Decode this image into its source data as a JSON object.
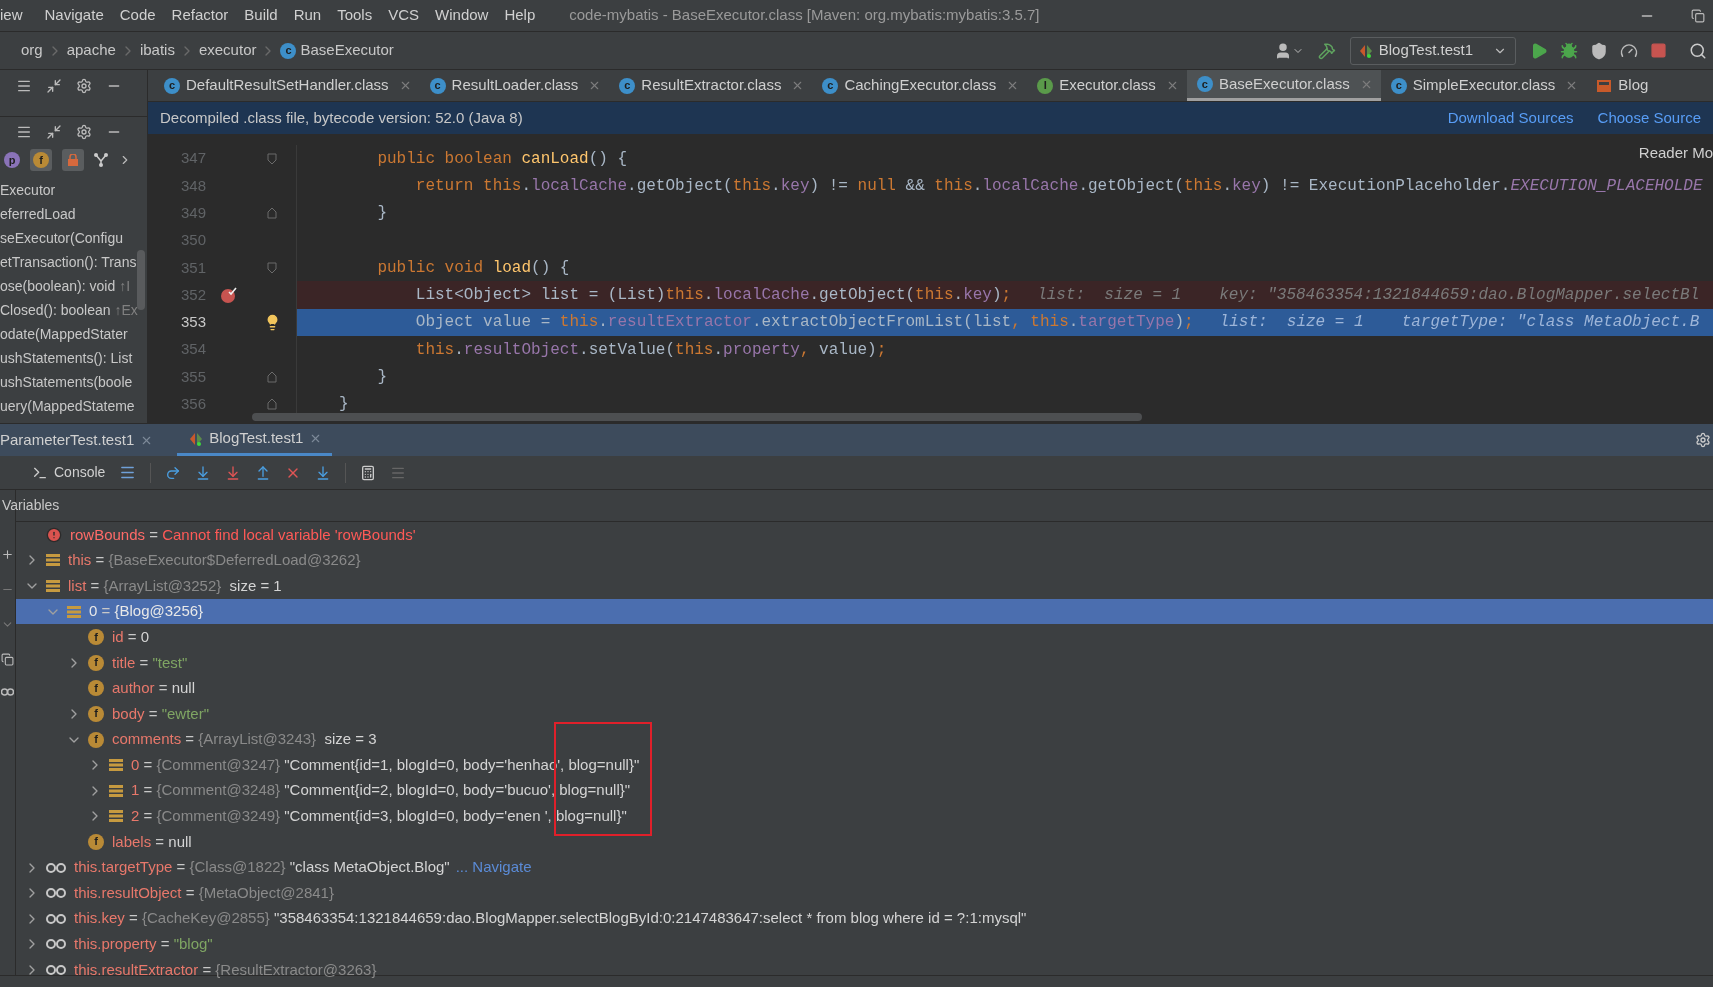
{
  "menu_bar": {
    "items": [
      "iew",
      "Navigate",
      "Code",
      "Refactor",
      "Build",
      "Run",
      "Tools",
      "VCS",
      "Window",
      "Help"
    ],
    "window_title": "code-mybatis - BaseExecutor.class [Maven: org.mybatis:mybatis:3.5.7]"
  },
  "breadcrumb": [
    {
      "label": "org",
      "kind": "package"
    },
    {
      "label": "apache",
      "kind": "package"
    },
    {
      "label": "ibatis",
      "kind": "package"
    },
    {
      "label": "executor",
      "kind": "package"
    },
    {
      "label": "BaseExecutor",
      "kind": "class",
      "icon_letter": "c"
    }
  ],
  "run_configuration": {
    "label": "BlogTest.test1"
  },
  "structure_panel": {
    "filter_letters": [
      "p",
      "f"
    ],
    "items": [
      {
        "label": "Executor"
      },
      {
        "label": "eferredLoad"
      },
      {
        "label": "seExecutor(Configu"
      },
      {
        "label": "etTransaction(): Trans"
      },
      {
        "label": "ose(boolean): void",
        "suffix": "↑I"
      },
      {
        "label": "Closed(): boolean",
        "suffix": "↑Ex"
      },
      {
        "label": "odate(MappedStater"
      },
      {
        "label": "ushStatements(): List"
      },
      {
        "label": "ushStatements(boole"
      },
      {
        "label": "uery(MappedStateme"
      }
    ]
  },
  "editor_tabs": [
    {
      "label": "DefaultResultSetHandler.class",
      "kind": "class",
      "icon_letter": "c",
      "selected": false
    },
    {
      "label": "ResultLoader.class",
      "kind": "class",
      "icon_letter": "c",
      "selected": false
    },
    {
      "label": "ResultExtractor.class",
      "kind": "class",
      "icon_letter": "c",
      "selected": false
    },
    {
      "label": "CachingExecutor.class",
      "kind": "class",
      "icon_letter": "c",
      "selected": false
    },
    {
      "label": "Executor.class",
      "kind": "interface",
      "icon_letter": "I",
      "selected": false
    },
    {
      "label": "BaseExecutor.class",
      "kind": "class",
      "icon_letter": "c",
      "selected": true
    },
    {
      "label": "SimpleExecutor.class",
      "kind": "class",
      "icon_letter": "c",
      "selected": false
    },
    {
      "label": "Blog",
      "kind": "xml",
      "selected": false
    }
  ],
  "banner": {
    "text": "Decompiled .class file, bytecode version: 52.0 (Java 8)",
    "links": [
      "Download Sources",
      "Choose Source"
    ]
  },
  "reader_mode": "Reader Mo",
  "code_lines": [
    {
      "number": "347",
      "fold": {
        "kind": "start"
      },
      "breakpoint": false,
      "execution_point": false,
      "tokens": [
        {
          "t": "    public boolean ",
          "kind": "kw"
        },
        {
          "t": "canLoad",
          "kind": "method"
        },
        {
          "t": "() {",
          "kind": "plain"
        }
      ]
    },
    {
      "number": "348",
      "breakpoint": false,
      "execution_point": false,
      "tokens": [
        {
          "t": "        return ",
          "kind": "kw"
        },
        {
          "t": "this",
          "kind": "kw"
        },
        {
          "t": ".",
          "kind": "plain"
        },
        {
          "t": "localCache",
          "kind": "field"
        },
        {
          "t": ".getObject(",
          "kind": "plain"
        },
        {
          "t": "this",
          "kind": "kw"
        },
        {
          "t": ".",
          "kind": "plain"
        },
        {
          "t": "key",
          "kind": "field"
        },
        {
          "t": ") != ",
          "kind": "plain"
        },
        {
          "t": "null",
          "kind": "kw"
        },
        {
          "t": " && ",
          "kind": "plain"
        },
        {
          "t": "this",
          "kind": "kw"
        },
        {
          "t": ".",
          "kind": "plain"
        },
        {
          "t": "localCache",
          "kind": "field"
        },
        {
          "t": ".getObject(",
          "kind": "plain"
        },
        {
          "t": "this",
          "kind": "kw"
        },
        {
          "t": ".",
          "kind": "plain"
        },
        {
          "t": "key",
          "kind": "field"
        },
        {
          "t": ") != ExecutionPlaceholder.",
          "kind": "plain"
        },
        {
          "t": "EXECUTION_PLACEHOLDE",
          "kind": "constant"
        }
      ]
    },
    {
      "number": "349",
      "fold": {
        "kind": "end"
      },
      "breakpoint": false,
      "execution_point": false,
      "tokens": [
        {
          "t": "    }",
          "kind": "plain"
        }
      ]
    },
    {
      "number": "350",
      "breakpoint": false,
      "execution_point": false
    },
    {
      "number": "351",
      "fold": {
        "kind": "start"
      },
      "breakpoint": false,
      "execution_point": false,
      "tokens": [
        {
          "t": "    public void ",
          "kind": "kw"
        },
        {
          "t": "load",
          "kind": "method"
        },
        {
          "t": "() {",
          "kind": "plain"
        }
      ]
    },
    {
      "number": "352",
      "breakpoint": true,
      "execution_point": false,
      "tokens": [
        {
          "t": "        List<Object> list = (List)",
          "kind": "plain"
        },
        {
          "t": "this",
          "kind": "kw"
        },
        {
          "t": ".",
          "kind": "plain"
        },
        {
          "t": "localCache",
          "kind": "field"
        },
        {
          "t": ".getObject(",
          "kind": "plain"
        },
        {
          "t": "this",
          "kind": "kw"
        },
        {
          "t": ".",
          "kind": "plain"
        },
        {
          "t": "key",
          "kind": "field"
        },
        {
          "t": ")",
          "kind": "plain"
        },
        {
          "t": ";",
          "kind": "kw"
        }
      ],
      "hints": [
        "list:  size = 1",
        "key: \"358463354:1321844659:dao.BlogMapper.selectBl"
      ]
    },
    {
      "number": "353",
      "breakpoint": false,
      "execution_point": true,
      "bulb": true,
      "tokens": [
        {
          "t": "        Object value = ",
          "kind": "plain"
        },
        {
          "t": "this",
          "kind": "kw"
        },
        {
          "t": ".",
          "kind": "plain"
        },
        {
          "t": "resultExtractor",
          "kind": "field"
        },
        {
          "t": ".extractObjectFromList(list",
          "kind": "plain"
        },
        {
          "t": ", ",
          "kind": "kw"
        },
        {
          "t": "this",
          "kind": "kw"
        },
        {
          "t": ".",
          "kind": "plain"
        },
        {
          "t": "targetType",
          "kind": "field"
        },
        {
          "t": ")",
          "kind": "plain"
        },
        {
          "t": ";",
          "kind": "kw"
        }
      ],
      "hints": [
        "list:  size = 1",
        "targetType: \"class MetaObject.B"
      ]
    },
    {
      "number": "354",
      "breakpoint": false,
      "execution_point": false,
      "tokens": [
        {
          "t": "        this",
          "kind": "kw"
        },
        {
          "t": ".",
          "kind": "plain"
        },
        {
          "t": "resultObject",
          "kind": "field"
        },
        {
          "t": ".setValue(",
          "kind": "plain"
        },
        {
          "t": "this",
          "kind": "kw"
        },
        {
          "t": ".",
          "kind": "plain"
        },
        {
          "t": "property",
          "kind": "field"
        },
        {
          "t": ", ",
          "kind": "kw"
        },
        {
          "t": "value)",
          "kind": "plain"
        },
        {
          "t": ";",
          "kind": "kw"
        }
      ]
    },
    {
      "number": "355",
      "fold": {
        "kind": "end"
      },
      "breakpoint": false,
      "execution_point": false,
      "tokens": [
        {
          "t": "    }",
          "kind": "plain"
        }
      ]
    },
    {
      "number": "356",
      "fold": {
        "kind": "end"
      },
      "breakpoint": false,
      "execution_point": false,
      "tokens": [
        {
          "t": "}",
          "kind": "plain"
        }
      ]
    }
  ],
  "debug": {
    "tabs": [
      {
        "label": "ParameterTest.test1",
        "selected": false
      },
      {
        "label": "BlogTest.test1",
        "selected": true
      }
    ],
    "console_label": "Console",
    "variables_title": "Variables",
    "annotation": {
      "kind": "rectangle",
      "color": "#e0202a"
    },
    "variables": [
      {
        "kind": "error",
        "name": "rowBounds",
        "equals": "=",
        "message": "Cannot find local variable 'rowBounds'",
        "selected": false
      },
      {
        "kind": "object",
        "name": "this",
        "equals": "=",
        "ref": "{BaseExecutor$DeferredLoad@3262}",
        "expanded": false,
        "selected": false
      },
      {
        "kind": "object",
        "name": "list",
        "equals": "=",
        "ref": "{ArrayList@3252}",
        "extra": "size = 1",
        "expanded": true,
        "selected": false,
        "children": [
          {
            "kind": "object",
            "name": "0",
            "equals": "=",
            "ref": "{Blog@3256}",
            "expanded": true,
            "selected": true,
            "children": [
              {
                "kind": "field",
                "icon_letter": "f",
                "name": "id",
                "equals": "=",
                "value": {
                  "text": "0",
                  "kind": "plain"
                },
                "selected": false
              },
              {
                "kind": "field",
                "icon_letter": "f",
                "name": "title",
                "equals": "=",
                "value": {
                  "text": "\"test\"",
                  "kind": "string"
                },
                "expanded": false,
                "selected": false
              },
              {
                "kind": "field",
                "icon_letter": "f",
                "name": "author",
                "equals": "=",
                "value": {
                  "text": "null",
                  "kind": "plain"
                },
                "selected": false
              },
              {
                "kind": "field",
                "icon_letter": "f",
                "name": "body",
                "equals": "=",
                "value": {
                  "text": "\"ewter\"",
                  "kind": "string"
                },
                "expanded": false,
                "selected": false
              },
              {
                "kind": "field",
                "icon_letter": "f",
                "name": "comments",
                "equals": "=",
                "ref": "{ArrayList@3243}",
                "extra": "size = 3",
                "expanded": true,
                "selected": false,
                "children": [
                  {
                    "kind": "object",
                    "name": "0",
                    "equals": "=",
                    "ref": "{Comment@3247}",
                    "value": {
                      "text": "\"Comment{id=1, blogId=0, body='henhao', blog=null}\"",
                      "kind": "plain"
                    },
                    "expanded": false,
                    "selected": false
                  },
                  {
                    "kind": "object",
                    "name": "1",
                    "equals": "=",
                    "ref": "{Comment@3248}",
                    "value": {
                      "text": "\"Comment{id=2, blogId=0, body='bucuo', blog=null}\"",
                      "kind": "plain"
                    },
                    "expanded": false,
                    "selected": false
                  },
                  {
                    "kind": "object",
                    "name": "2",
                    "equals": "=",
                    "ref": "{Comment@3249}",
                    "value": {
                      "text": "\"Comment{id=3, blogId=0, body='enen ', blog=null}\"",
                      "kind": "plain"
                    },
                    "expanded": false,
                    "selected": false
                  }
                ]
              },
              {
                "kind": "field",
                "icon_letter": "f",
                "name": "labels",
                "equals": "=",
                "value": {
                  "text": "null",
                  "kind": "plain"
                },
                "selected": false
              }
            ]
          }
        ]
      },
      {
        "kind": "watch",
        "name": "this.targetType",
        "equals": "=",
        "ref": "{Class@1822}",
        "value": {
          "text": "\"class MetaObject.Blog\"",
          "kind": "plain"
        },
        "link": "... Navigate",
        "expanded": false,
        "selected": false
      },
      {
        "kind": "watch",
        "name": "this.resultObject",
        "equals": "=",
        "ref": "{MetaObject@2841}",
        "expanded": false,
        "selected": false
      },
      {
        "kind": "watch",
        "name": "this.key",
        "equals": "=",
        "ref": "{CacheKey@2855}",
        "value": {
          "text": "\"358463354:1321844659:dao.BlogMapper.selectBlogById:0:2147483647:select * from blog where id = ?:1:mysql\"",
          "kind": "plain"
        },
        "expanded": false,
        "selected": false
      },
      {
        "kind": "watch",
        "name": "this.property",
        "equals": "=",
        "value": {
          "text": "\"blog\"",
          "kind": "string"
        },
        "expanded": false,
        "selected": false
      },
      {
        "kind": "watch",
        "name": "this.resultExtractor",
        "equals": "=",
        "ref": "{ResultExtractor@3263}",
        "expanded": false,
        "selected": false
      }
    ]
  }
}
